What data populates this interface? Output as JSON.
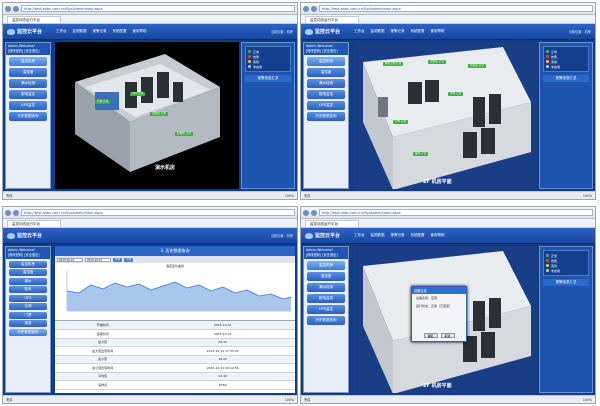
{
  "browser": {
    "address": "http://test.ahbc.com.cn/SysAdmin/main.aspx",
    "tab_title": "监控动态运行平台",
    "status_left": "完成",
    "zoom": "100%"
  },
  "app": {
    "logo_text": "监控云平台",
    "menu": [
      "工作台",
      "监测数据",
      "报警记录",
      "系统配置",
      "使用帮助"
    ],
    "header_right": "当前位置：机房",
    "user": "Admin,Welcome!",
    "user_sub": "[修改密码] [安全退出]"
  },
  "q1": {
    "sidebar": [
      "监控机房",
      "温湿度",
      "漏水检测",
      "配电监控",
      "UPS监控",
      "历史数据查询"
    ],
    "caption": "演示机房",
    "labels": [
      "空调 正常",
      "温湿度 正常",
      "UPS 正常",
      "配电柜 正常"
    ],
    "legend": [
      {
        "text": "正常",
        "color": "#2ecc40"
      },
      {
        "text": "告警",
        "color": "#ff3b30"
      },
      {
        "text": "离线",
        "color": "#ffcc00"
      },
      {
        "text": "未启用",
        "color": "#c9c9c9"
      }
    ],
    "panel_title": "报警信息汇总"
  },
  "q2": {
    "sidebar": [
      "监控机房",
      "温湿度",
      "漏水检测",
      "配电监控",
      "UPS监控",
      "历史数据查询"
    ],
    "caption": "2F 机房平面",
    "labels": [
      "精密空调 正常",
      "温湿度 正常",
      "温湿度 正常",
      "UPS 正常",
      "配电 正常",
      "漏水 正常"
    ],
    "legend": [
      {
        "text": "正常",
        "color": "#2ecc40"
      },
      {
        "text": "告警",
        "color": "#ff3b30"
      },
      {
        "text": "离线",
        "color": "#ffcc00"
      },
      {
        "text": "未启用",
        "color": "#c9c9c9"
      }
    ],
    "panel_title": "报警信息汇总"
  },
  "q3": {
    "sidebar": [
      "监控机房",
      "温湿度",
      "漏水",
      "配电",
      "UPS",
      "空调",
      "门禁",
      "烟感",
      "历史数据查询"
    ],
    "title": "3. 历史数据查询",
    "toolbar": {
      "start": "2015-10-01",
      "end": "2015-10-31",
      "query": "查询",
      "export": "导出"
    },
    "chart_title": "温度变化曲线",
    "table": [
      [
        "开始时间",
        "2015-10-01"
      ],
      [
        "结束时间",
        "2015-10-31"
      ],
      [
        "最大值",
        "26.30"
      ],
      [
        "最大值出现时间",
        "2015-10-12 17:35:44"
      ],
      [
        "最小值",
        "18.20"
      ],
      [
        "最小值出现时间",
        "2015-10-21 03:12:56"
      ],
      [
        "平均值",
        "22.40"
      ],
      [
        "采样点",
        "8760"
      ]
    ]
  },
  "q4": {
    "sidebar": [
      "监控机房",
      "温湿度",
      "漏水检测",
      "配电监控",
      "UPS监控",
      "历史数据查询"
    ],
    "caption": "2F 机房平面",
    "legend": [
      {
        "text": "正常",
        "color": "#2ecc40"
      },
      {
        "text": "告警",
        "color": "#ff3b30"
      },
      {
        "text": "离线",
        "color": "#ffcc00"
      },
      {
        "text": "未启用",
        "color": "#c9c9c9"
      }
    ],
    "panel_title": "报警信息汇总",
    "dialog": {
      "title": "设备信息",
      "row1": "设备名称：空调",
      "row2": "运行状态：正常（已连接）",
      "ok": "确定",
      "cancel": "取消"
    }
  }
}
